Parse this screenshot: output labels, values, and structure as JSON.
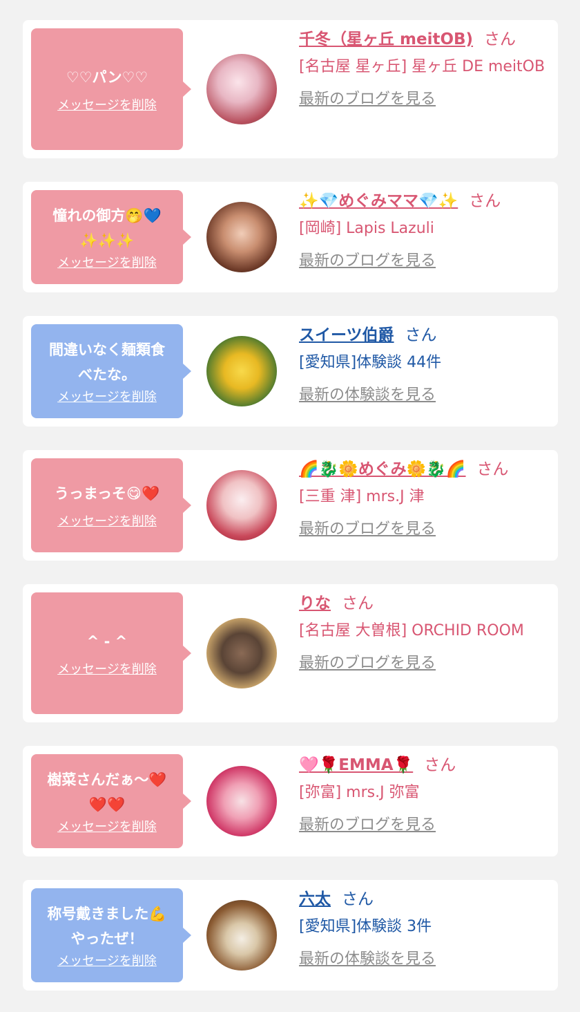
{
  "messages": [
    {
      "bubble_color": "#ef9aa4",
      "message": "♡♡パン♡♡",
      "delete_label": "メッセージを削除",
      "avatar": "avatar-photo",
      "name": "千冬（星ヶ丘 meitOB)",
      "honorific": "さん",
      "shop": "[名古屋 星ヶ丘] 星ヶ丘 DE meitOB",
      "link_label": "最新のブログを見る"
    },
    {
      "bubble_color": "#ef9aa4",
      "message": "憧れの御方🤭💙\n✨✨✨",
      "delete_label": "メッセージを削除",
      "avatar": "avatar-photo",
      "name": "✨💎めぐみママ💎✨",
      "honorific": "さん",
      "shop": "[岡崎] Lapis Lazuli",
      "link_label": "最新のブログを見る"
    },
    {
      "bubble_color": "#93b4ee",
      "message": "間違いなく麺類食\nべたな。",
      "delete_label": "メッセージを削除",
      "avatar": "avatar-photo",
      "name": "スイーツ伯爵",
      "honorific": "さん",
      "shop": "[愛知県]体験談 44件",
      "link_label": "最新の体験談を見る"
    },
    {
      "bubble_color": "#ef9aa4",
      "message": "うっまっそ😋❤️",
      "delete_label": "メッセージを削除",
      "avatar": "avatar-photo",
      "name": "🌈🐉🌼めぐみ🌼🐉🌈",
      "honorific": "さん",
      "shop": "[三重 津] mrs.J 津",
      "link_label": "最新のブログを見る"
    },
    {
      "bubble_color": "#ef9aa4",
      "message": "^ - ^",
      "delete_label": "メッセージを削除",
      "avatar": "avatar-photo",
      "name": "りな",
      "honorific": "さん",
      "shop": "[名古屋 大曽根] ORCHID ROOM",
      "link_label": "最新のブログを見る"
    },
    {
      "bubble_color": "#ef9aa4",
      "message": "樹菜さんだぁ〜❤️\n❤️❤️",
      "delete_label": "メッセージを削除",
      "avatar": "avatar-photo",
      "name": "🩷🌹EMMA🌹",
      "honorific": "さん",
      "shop": "[弥富] mrs.J 弥富",
      "link_label": "最新のブログを見る"
    },
    {
      "bubble_color": "#93b4ee",
      "message": "称号戴きました💪\nやったぜ！",
      "delete_label": "メッセージを削除",
      "avatar": "avatar-photo",
      "name": "六太",
      "honorific": "さん",
      "shop": "[愛知県]体験談 3件",
      "link_label": "最新の体験談を見る"
    }
  ]
}
